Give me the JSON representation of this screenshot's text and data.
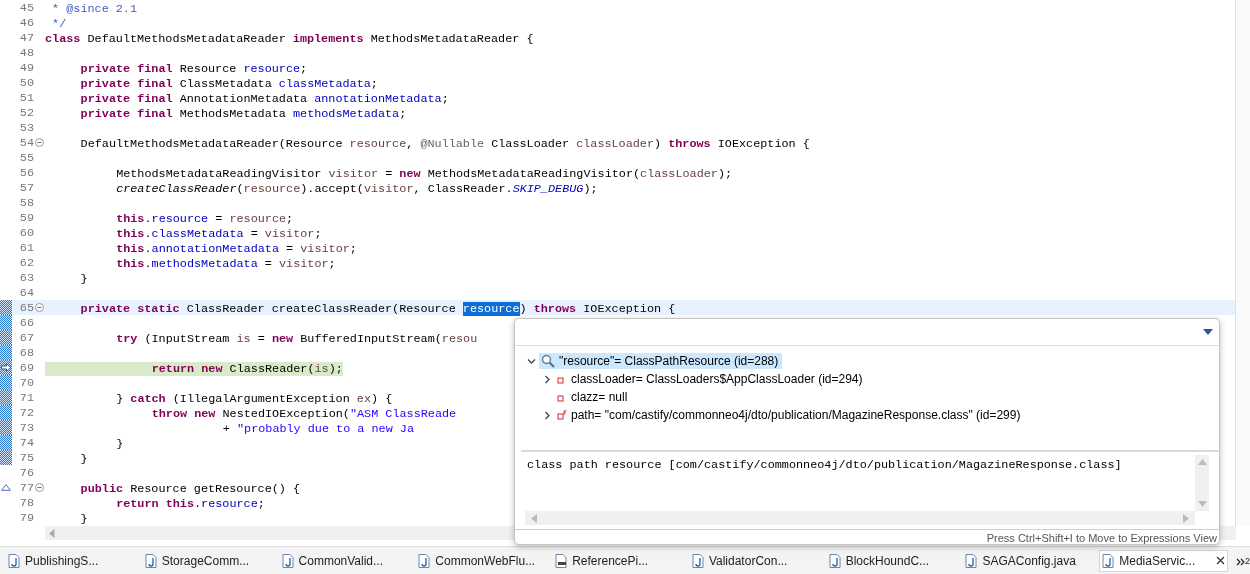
{
  "editor": {
    "lines": [
      {
        "number": "45",
        "fold": false,
        "range": false,
        "tokens": [
          {
            "kind": "comment",
            "t": " * @since 2.1"
          }
        ]
      },
      {
        "number": "46",
        "fold": false,
        "range": false,
        "tokens": [
          {
            "kind": "comment",
            "t": " */"
          }
        ]
      },
      {
        "number": "47",
        "fold": false,
        "range": false,
        "tokens": [
          {
            "kind": "keyword",
            "t": "class"
          },
          {
            "kind": "plain",
            "t": " DefaultMethodsMetadataReader "
          },
          {
            "kind": "keyword",
            "t": "implements"
          },
          {
            "kind": "plain",
            "t": " MethodsMetadataReader {"
          }
        ]
      },
      {
        "number": "48",
        "fold": false,
        "range": false
      },
      {
        "number": "49",
        "fold": false,
        "range": false,
        "tokens": [
          {
            "kind": "keyword",
            "t": "\tprivate"
          },
          {
            "kind": "keyword",
            "t": " final"
          },
          {
            "kind": "plain",
            "t": " Resource "
          },
          {
            "kind": "field",
            "t": "resource"
          },
          {
            "kind": "plain",
            "t": ";"
          }
        ]
      },
      {
        "number": "50",
        "fold": false,
        "range": false,
        "tokens": [
          {
            "kind": "keyword",
            "t": "\tprivate"
          },
          {
            "kind": "keyword",
            "t": " final"
          },
          {
            "kind": "plain",
            "t": " ClassMetadata "
          },
          {
            "kind": "field",
            "t": "classMetadata"
          },
          {
            "kind": "plain",
            "t": ";"
          }
        ]
      },
      {
        "number": "51",
        "fold": false,
        "range": false,
        "tokens": [
          {
            "kind": "keyword",
            "t": "\tprivate"
          },
          {
            "kind": "keyword",
            "t": " final"
          },
          {
            "kind": "plain",
            "t": " AnnotationMetadata "
          },
          {
            "kind": "field",
            "t": "annotationMetadata"
          },
          {
            "kind": "plain",
            "t": ";"
          }
        ]
      },
      {
        "number": "52",
        "fold": false,
        "range": false,
        "tokens": [
          {
            "kind": "keyword",
            "t": "\tprivate"
          },
          {
            "kind": "keyword",
            "t": " final"
          },
          {
            "kind": "plain",
            "t": " MethodsMetadata "
          },
          {
            "kind": "field",
            "t": "methodsMetadata"
          },
          {
            "kind": "plain",
            "t": ";"
          }
        ]
      },
      {
        "number": "53",
        "fold": false,
        "range": false
      },
      {
        "number": "54",
        "fold": true,
        "range": false,
        "tokens": [
          {
            "kind": "plain",
            "t": "\tDefaultMethodsMetadataReader(Resource "
          },
          {
            "kind": "local",
            "t": "resource"
          },
          {
            "kind": "plain",
            "t": ", "
          },
          {
            "kind": "annotation",
            "t": "@Nullable"
          },
          {
            "kind": "plain",
            "t": " ClassLoader "
          },
          {
            "kind": "local",
            "t": "classLoader"
          },
          {
            "kind": "plain",
            "t": ") "
          },
          {
            "kind": "keyword",
            "t": "throws"
          },
          {
            "kind": "plain",
            "t": " IOException {"
          }
        ]
      },
      {
        "number": "55",
        "fold": false,
        "range": false
      },
      {
        "number": "56",
        "fold": false,
        "range": false,
        "tokens": [
          {
            "kind": "plain",
            "t": "\t\tMethodsMetadataReadingVisitor "
          },
          {
            "kind": "local",
            "t": "visitor"
          },
          {
            "kind": "plain",
            "t": " = "
          },
          {
            "kind": "keyword",
            "t": "new"
          },
          {
            "kind": "plain",
            "t": " MethodsMetadataReadingVisitor("
          },
          {
            "kind": "local",
            "t": "classLoader"
          },
          {
            "kind": "plain",
            "t": ");"
          }
        ]
      },
      {
        "number": "57",
        "fold": false,
        "range": false,
        "tokens": [
          {
            "kind": "static_method",
            "t": "\t\tcreateClassReader"
          },
          {
            "kind": "plain",
            "t": "("
          },
          {
            "kind": "local",
            "t": "resource"
          },
          {
            "kind": "plain",
            "t": ").accept("
          },
          {
            "kind": "local",
            "t": "visitor"
          },
          {
            "kind": "plain",
            "t": ", ClassReader."
          },
          {
            "kind": "static_field",
            "t": "SKIP_DEBUG"
          },
          {
            "kind": "plain",
            "t": ");"
          }
        ]
      },
      {
        "number": "58",
        "fold": false,
        "range": false
      },
      {
        "number": "59",
        "fold": false,
        "range": false,
        "tokens": [
          {
            "kind": "keyword",
            "t": "\t\tthis"
          },
          {
            "kind": "plain",
            "t": "."
          },
          {
            "kind": "field",
            "t": "resource"
          },
          {
            "kind": "plain",
            "t": " = "
          },
          {
            "kind": "local",
            "t": "resource"
          },
          {
            "kind": "plain",
            "t": ";"
          }
        ]
      },
      {
        "number": "60",
        "fold": false,
        "range": false,
        "tokens": [
          {
            "kind": "keyword",
            "t": "\t\tthis"
          },
          {
            "kind": "plain",
            "t": "."
          },
          {
            "kind": "field",
            "t": "classMetadata"
          },
          {
            "kind": "plain",
            "t": " = "
          },
          {
            "kind": "local",
            "t": "visitor"
          },
          {
            "kind": "plain",
            "t": ";"
          }
        ]
      },
      {
        "number": "61",
        "fold": false,
        "range": false,
        "tokens": [
          {
            "kind": "keyword",
            "t": "\t\tthis"
          },
          {
            "kind": "plain",
            "t": "."
          },
          {
            "kind": "field",
            "t": "annotationMetadata"
          },
          {
            "kind": "plain",
            "t": " = "
          },
          {
            "kind": "local",
            "t": "visitor"
          },
          {
            "kind": "plain",
            "t": ";"
          }
        ]
      },
      {
        "number": "62",
        "fold": false,
        "range": false,
        "tokens": [
          {
            "kind": "keyword",
            "t": "\t\tthis"
          },
          {
            "kind": "plain",
            "t": "."
          },
          {
            "kind": "field",
            "t": "methodsMetadata"
          },
          {
            "kind": "plain",
            "t": " = "
          },
          {
            "kind": "local",
            "t": "visitor"
          },
          {
            "kind": "plain",
            "t": ";"
          }
        ]
      },
      {
        "number": "63",
        "fold": false,
        "range": false,
        "tokens": [
          {
            "kind": "plain",
            "t": "\t}"
          }
        ]
      },
      {
        "number": "64",
        "fold": false,
        "range": false
      },
      {
        "number": "65",
        "fold": true,
        "range": true,
        "highlight": {
          "kind": "cursor_line"
        },
        "tokens": [
          {
            "kind": "keyword",
            "t": "\tprivate"
          },
          {
            "kind": "keyword",
            "t": " static"
          },
          {
            "kind": "plain",
            "t": " ClassReader createClassReader(Resource "
          },
          {
            "kind": "selection",
            "t": "resource"
          },
          {
            "kind": "plain",
            "t": ") "
          },
          {
            "kind": "keyword",
            "t": "throws"
          },
          {
            "kind": "plain",
            "t": " IOException {"
          }
        ]
      },
      {
        "number": "66",
        "fold": false,
        "range": true
      },
      {
        "number": "67",
        "fold": false,
        "range": true,
        "tokens": [
          {
            "kind": "keyword",
            "t": "\t\ttry"
          },
          {
            "kind": "plain",
            "t": " (InputStream "
          },
          {
            "kind": "local",
            "t": "is"
          },
          {
            "kind": "plain",
            "t": " = "
          },
          {
            "kind": "keyword",
            "t": "new"
          },
          {
            "kind": "plain",
            "t": " BufferedInputStream("
          },
          {
            "kind": "local",
            "t": "resou"
          }
        ]
      },
      {
        "number": "68",
        "fold": false,
        "range": true
      },
      {
        "number": "69",
        "fold": false,
        "range": true,
        "highlight": {
          "kind": "current_instruction"
        },
        "gutter_icon": {
          "kind": "instruction_pointer"
        },
        "tokens": [
          {
            "kind": "keyword",
            "t": "\t\t\treturn"
          },
          {
            "kind": "keyword",
            "t": " new"
          },
          {
            "kind": "plain",
            "t": " ClassReader("
          },
          {
            "kind": "local",
            "t": "is"
          },
          {
            "kind": "plain",
            "t": ");"
          }
        ]
      },
      {
        "number": "70",
        "fold": false,
        "range": true
      },
      {
        "number": "71",
        "fold": false,
        "range": true,
        "tokens": [
          {
            "kind": "plain",
            "t": "\t\t} "
          },
          {
            "kind": "keyword",
            "t": "catch"
          },
          {
            "kind": "plain",
            "t": " (IllegalArgumentException "
          },
          {
            "kind": "local",
            "t": "ex"
          },
          {
            "kind": "plain",
            "t": ") {"
          }
        ]
      },
      {
        "number": "72",
        "fold": false,
        "range": true,
        "tokens": [
          {
            "kind": "keyword",
            "t": "\t\t\tthrow"
          },
          {
            "kind": "keyword",
            "t": " new"
          },
          {
            "kind": "plain",
            "t": " NestedIOException("
          },
          {
            "kind": "string",
            "t": "\"ASM ClassReade"
          }
        ]
      },
      {
        "number": "73",
        "fold": false,
        "range": true,
        "tokens": [
          {
            "kind": "plain",
            "t": "\t\t\t\t\t+ "
          },
          {
            "kind": "string",
            "t": "\"probably due to a new Ja"
          }
        ]
      },
      {
        "number": "74",
        "fold": false,
        "range": true,
        "tokens": [
          {
            "kind": "plain",
            "t": "\t\t}"
          }
        ]
      },
      {
        "number": "75",
        "fold": false,
        "range": true,
        "tokens": [
          {
            "kind": "plain",
            "t": "\t}"
          }
        ]
      },
      {
        "number": "76",
        "fold": false,
        "range": false
      },
      {
        "number": "77",
        "fold": true,
        "range": false,
        "gutter_icon": {
          "kind": "override"
        },
        "tokens": [
          {
            "kind": "keyword",
            "t": "\tpublic"
          },
          {
            "kind": "plain",
            "t": " Resource getResource() {"
          }
        ]
      },
      {
        "number": "78",
        "fold": false,
        "range": false,
        "tokens": [
          {
            "kind": "keyword",
            "t": "\t\treturn"
          },
          {
            "kind": "keyword",
            "t": " this"
          },
          {
            "kind": "plain",
            "t": "."
          },
          {
            "kind": "field",
            "t": "resource"
          },
          {
            "kind": "plain",
            "t": ";"
          }
        ]
      },
      {
        "number": "79",
        "fold": false,
        "range": false,
        "tokens": [
          {
            "kind": "plain",
            "t": "\t}"
          }
        ]
      }
    ]
  },
  "hover": {
    "tree": [
      {
        "label": "\"resource\"= ClassPathResource  (id=288)",
        "kind": "expression",
        "selected": true,
        "expanded": true,
        "children": [
          {
            "label": "classLoader= ClassLoaders$AppClassLoader  (id=294)",
            "kind": "field",
            "selected": false,
            "expanded": false
          },
          {
            "label": "clazz= null",
            "kind": "field",
            "selected": false
          },
          {
            "label": "path= \"com/castify/commonneo4j/dto/publication/MagazineResponse.class\" (id=299)",
            "kind": "final_field",
            "selected": false,
            "expanded": false
          }
        ]
      }
    ],
    "detail": "class path resource [com/castify/commonneo4j/dto/publication/MagazineResponse.class]",
    "hint": "Press Ctrl+Shift+I to Move to Expressions View"
  },
  "tabs": [
    {
      "label": "PublishingS...",
      "kind": "java",
      "selected": false
    },
    {
      "label": "StorageComm...",
      "kind": "java",
      "selected": false
    },
    {
      "label": "CommonValid...",
      "kind": "java",
      "selected": false
    },
    {
      "label": "CommonWebFlu...",
      "kind": "java",
      "selected": false
    },
    {
      "label": "ReferencePi...",
      "kind": "class",
      "selected": false
    },
    {
      "label": "ValidatorCon...",
      "kind": "java",
      "selected": false
    },
    {
      "label": "BlockHoundC...",
      "kind": "java",
      "selected": false
    },
    {
      "label": "SAGAConfig.java",
      "kind": "java",
      "selected": false
    },
    {
      "label": "MediaServic...",
      "kind": "java",
      "selected": true
    }
  ],
  "tabs_overflow": "2"
}
